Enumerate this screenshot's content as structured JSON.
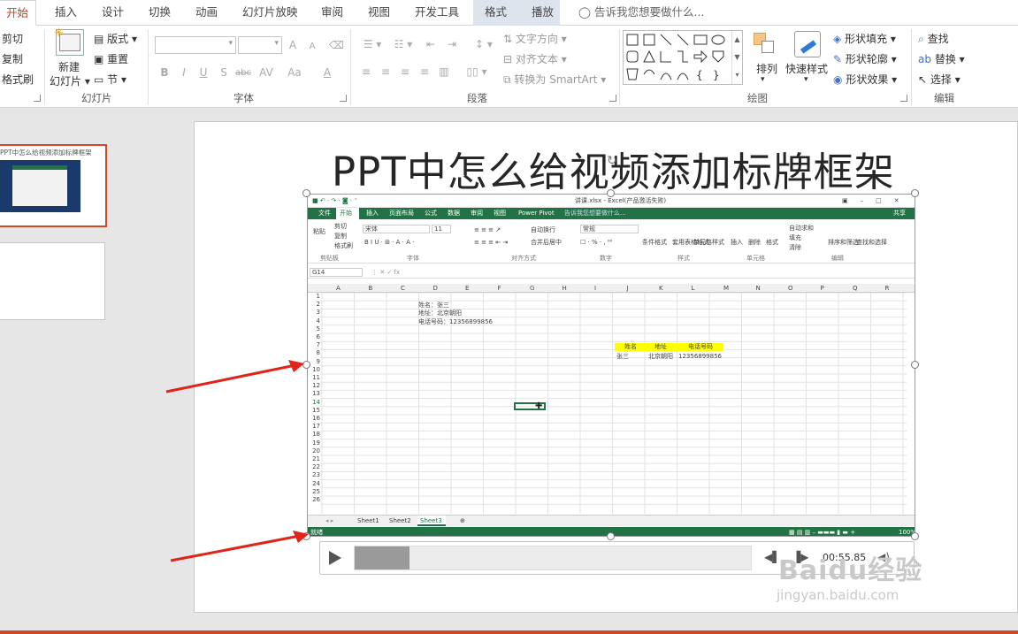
{
  "tabs": [
    "开始",
    "插入",
    "设计",
    "切换",
    "动画",
    "幻灯片放映",
    "审阅",
    "视图",
    "开发工具",
    "格式",
    "播放"
  ],
  "tell_me": "告诉我您想要做什么...",
  "clipboard": {
    "cut": "剪切",
    "copy": "复制",
    "painter": "格式刷"
  },
  "slides_group": {
    "new_slide": "新建",
    "new_slide2": "幻灯片",
    "layout": "版式",
    "reset": "重置",
    "section": "节",
    "label": "幻灯片"
  },
  "font_group": {
    "label": "字体",
    "bold": "B",
    "italic": "I",
    "underline": "U",
    "shadow": "S",
    "strike": "abc",
    "spacing": "AV",
    "case": "Aa",
    "color": "A",
    "grow": "A",
    "shrink": "A"
  },
  "para_group": {
    "label": "段落",
    "direction": "文字方向",
    "align": "对齐文本",
    "smartart": "转换为 SmartArt"
  },
  "draw_group": {
    "label": "绘图",
    "arrange": "排列",
    "quick_styles": "快速样式",
    "fill": "形状填充",
    "outline": "形状轮廓",
    "effects": "形状效果"
  },
  "edit_group": {
    "label": "编辑",
    "find": "查找",
    "replace": "替换",
    "select": "选择"
  },
  "thumb_title": "PPT中怎么给视频添加标牌框架",
  "slide_title": "PPT中怎么给视频添加标牌框架",
  "excel": {
    "title": "讲课.xlsx - Excel(产品激活失败)",
    "tabs": [
      "文件",
      "开始",
      "插入",
      "页面布局",
      "公式",
      "数据",
      "审阅",
      "视图",
      "Power Pivot"
    ],
    "tell": "告诉我您想要做什么...",
    "share": "共享",
    "font_name": "宋体",
    "font_size": "11",
    "number_format": "常规",
    "wrap": "自动换行",
    "merge": "合并后居中",
    "clipboard_items": [
      "剪切",
      "复制",
      "格式刷"
    ],
    "paste": "粘贴",
    "styles": [
      "条件格式",
      "套用表格格式",
      "单元格样式"
    ],
    "cells": [
      "插入",
      "删除",
      "格式"
    ],
    "editing": [
      "自动求和",
      "填充",
      "清除",
      "排序和筛选",
      "查找和选择"
    ],
    "groups": [
      "剪贴板",
      "字体",
      "对齐方式",
      "数字",
      "样式",
      "单元格",
      "编辑"
    ],
    "name_box": "G14",
    "columns": [
      "A",
      "B",
      "C",
      "D",
      "E",
      "F",
      "G",
      "H",
      "I",
      "J",
      "K",
      "L",
      "M",
      "N",
      "O",
      "P",
      "Q",
      "R"
    ],
    "rows": [
      "1",
      "2",
      "3",
      "4",
      "5",
      "6",
      "7",
      "8",
      "9",
      "10",
      "11",
      "12",
      "13",
      "14",
      "15",
      "16",
      "17",
      "18",
      "19",
      "20",
      "21",
      "22",
      "23",
      "24",
      "25",
      "26"
    ],
    "lines": [
      "姓名：张三",
      "地址：北京朝阳",
      "电话号码：12356899856"
    ],
    "table_headers": [
      "姓名",
      "地址",
      "电话号码"
    ],
    "table_row": [
      "张三",
      "北京朝阳",
      "12356899856"
    ],
    "sheets": [
      "Sheet1",
      "Sheet2",
      "Sheet3"
    ],
    "status": "就绪",
    "zoom": "100%"
  },
  "player": {
    "time": "00:55.85"
  },
  "watermark": {
    "logo": "Baidu经验",
    "url": "jingyan.baidu.com"
  },
  "colors": {
    "accent": "#d24726",
    "excel_green": "#217346",
    "table_yellow": "#ffff00"
  }
}
